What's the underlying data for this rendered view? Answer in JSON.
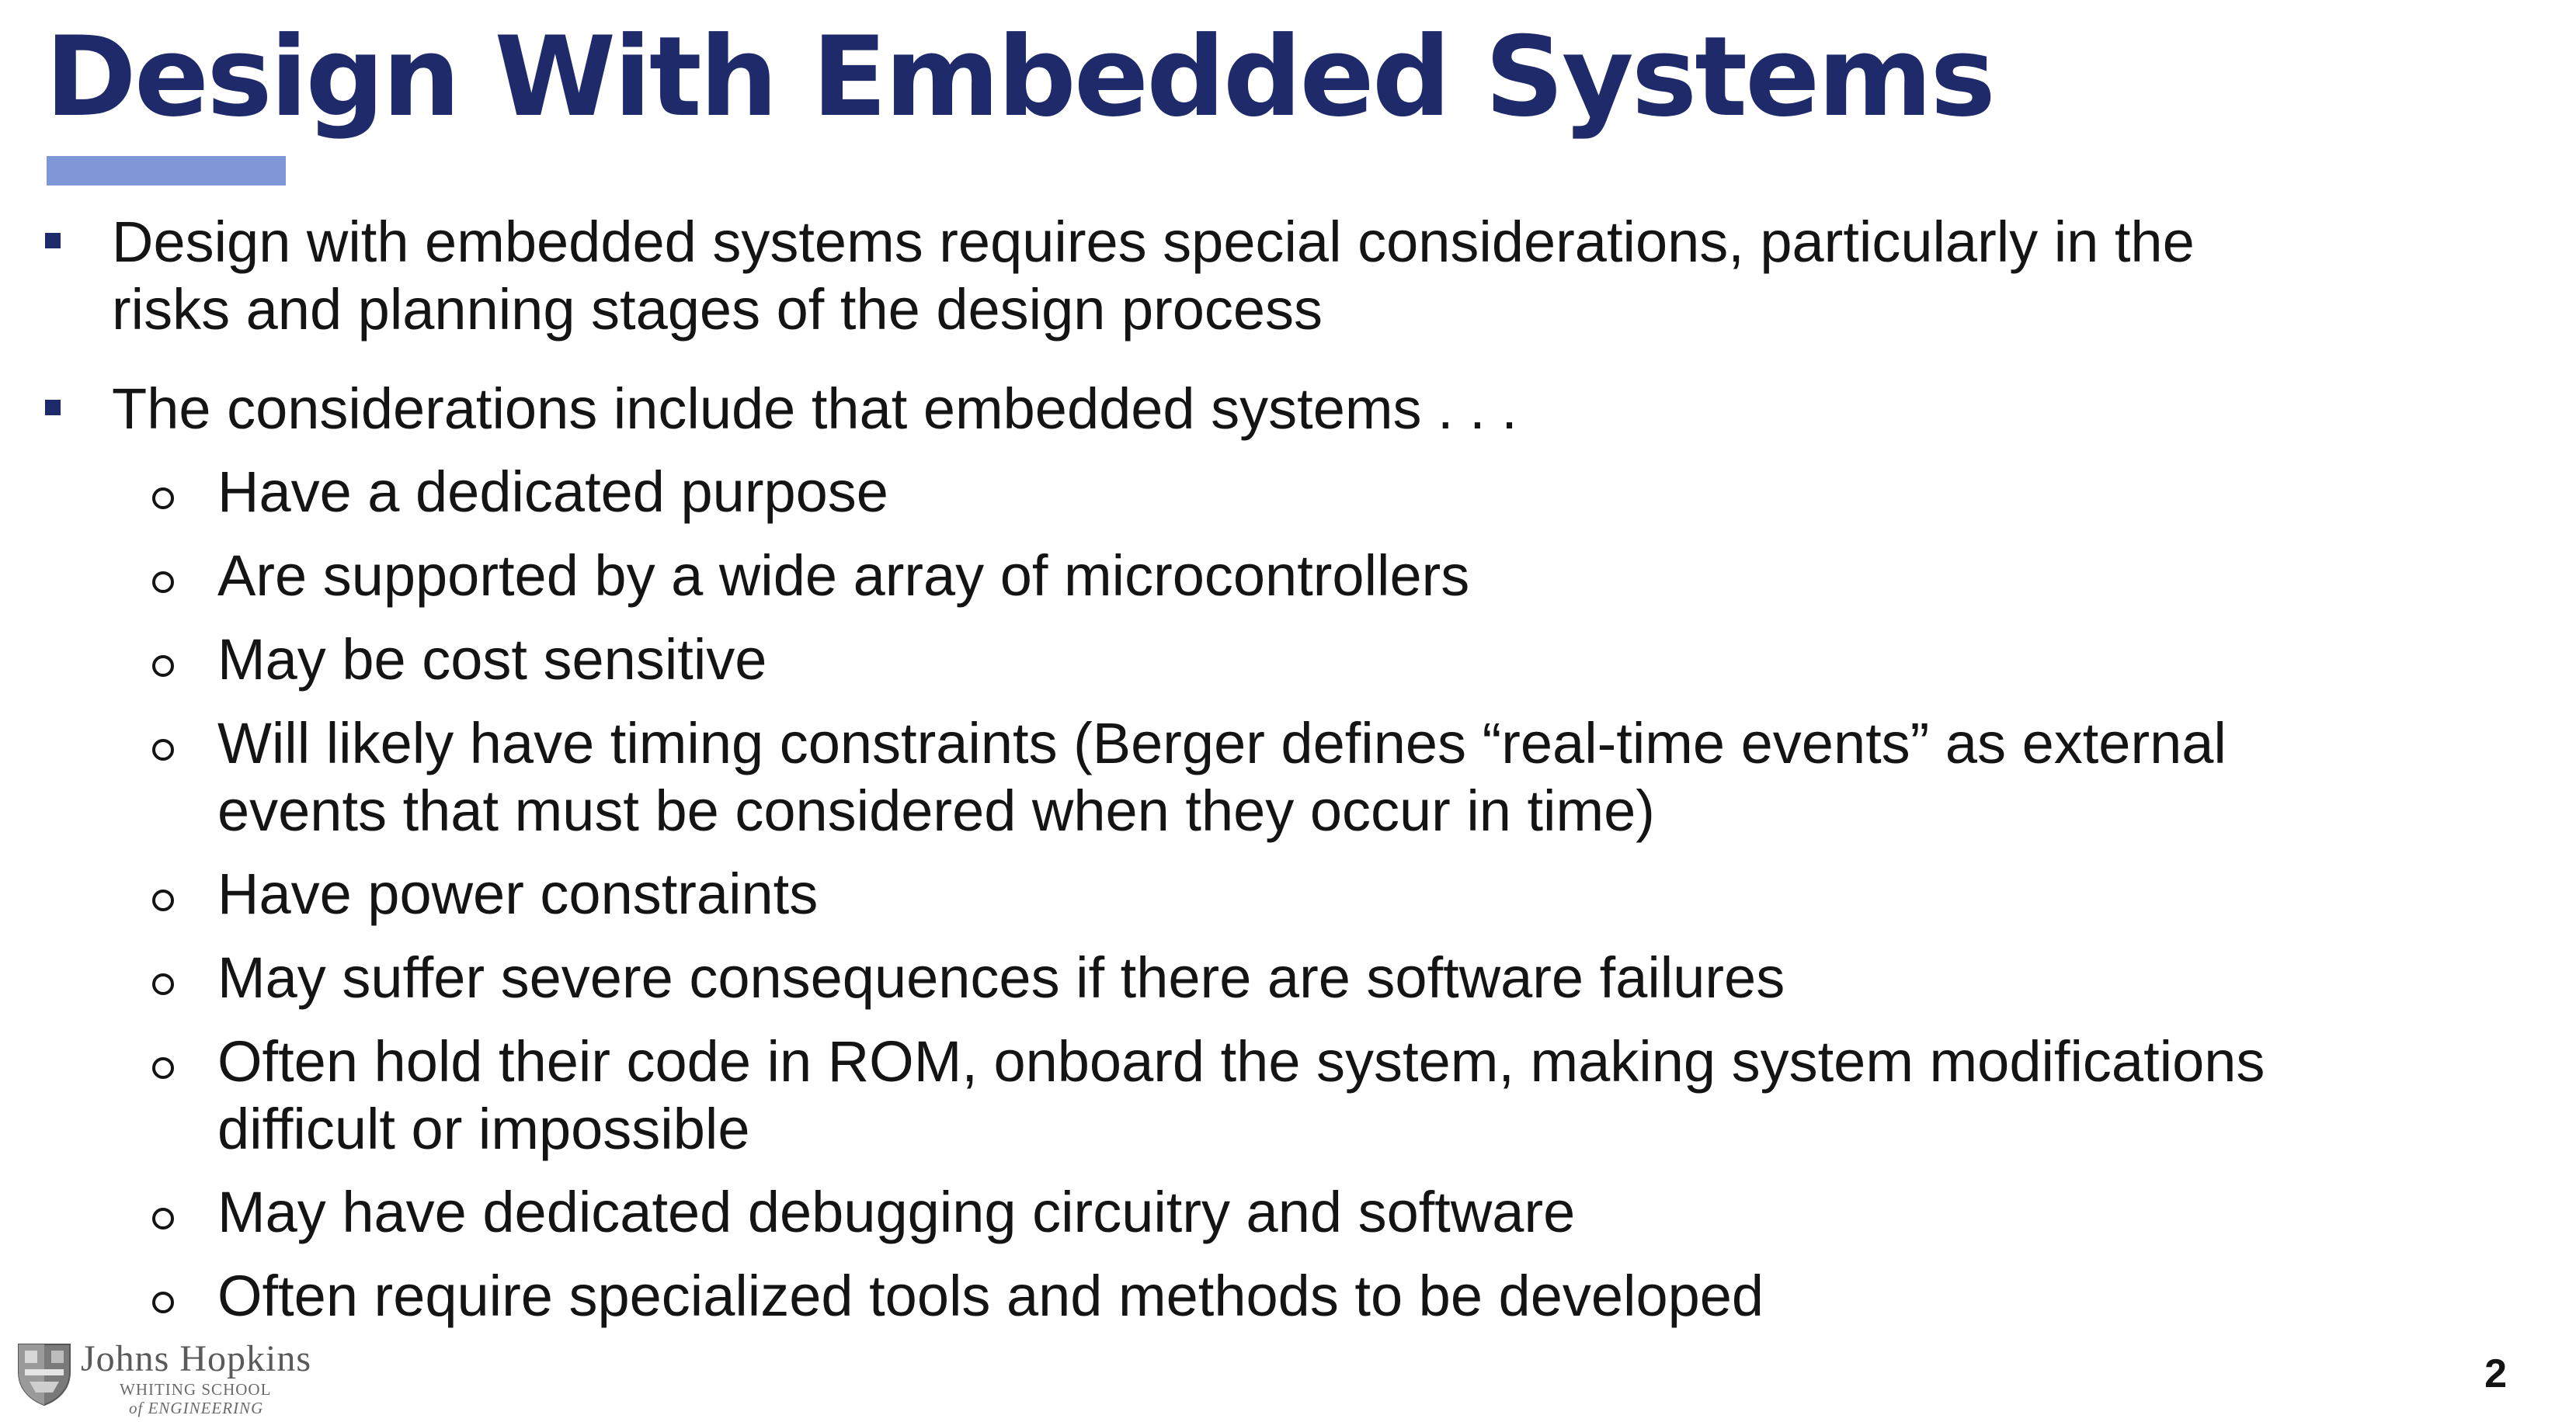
{
  "slide": {
    "title": "Design With Embedded Systems",
    "page_number": "2"
  },
  "bullets": {
    "b1": {
      "line1": "Design with embedded systems requires special considerations, particularly in the",
      "line2": "risks and planning stages of the design process"
    },
    "b2": {
      "line1": "The considerations include that embedded systems . . ."
    }
  },
  "sub_bullets": {
    "s1": {
      "line1": "Have a dedicated purpose"
    },
    "s2": {
      "line1": "Are supported by a wide array of microcontrollers"
    },
    "s3": {
      "line1": "May be cost sensitive"
    },
    "s4": {
      "line1": "Will likely have timing constraints (Berger defines “real-time events” as external",
      "line2": "events that must be considered when they occur in time)"
    },
    "s5": {
      "line1": "Have power constraints"
    },
    "s6": {
      "line1": "May suffer severe consequences if there are software failures"
    },
    "s7": {
      "line1": "Often hold their code in ROM, onboard the system, making system modifications",
      "line2": "difficult or impossible"
    },
    "s8": {
      "line1": "May have dedicated debugging circuitry and software"
    },
    "s9": {
      "line1": "Often require specialized tools and methods to be developed"
    }
  },
  "logo": {
    "name": "Johns Hopkins",
    "sub_line1": "WHITING SCHOOL",
    "sub_line2": "of ENGINEERING"
  },
  "colors": {
    "title": "#1f2a6b",
    "accent_bar": "#7f97d6",
    "body_text": "#141414"
  }
}
